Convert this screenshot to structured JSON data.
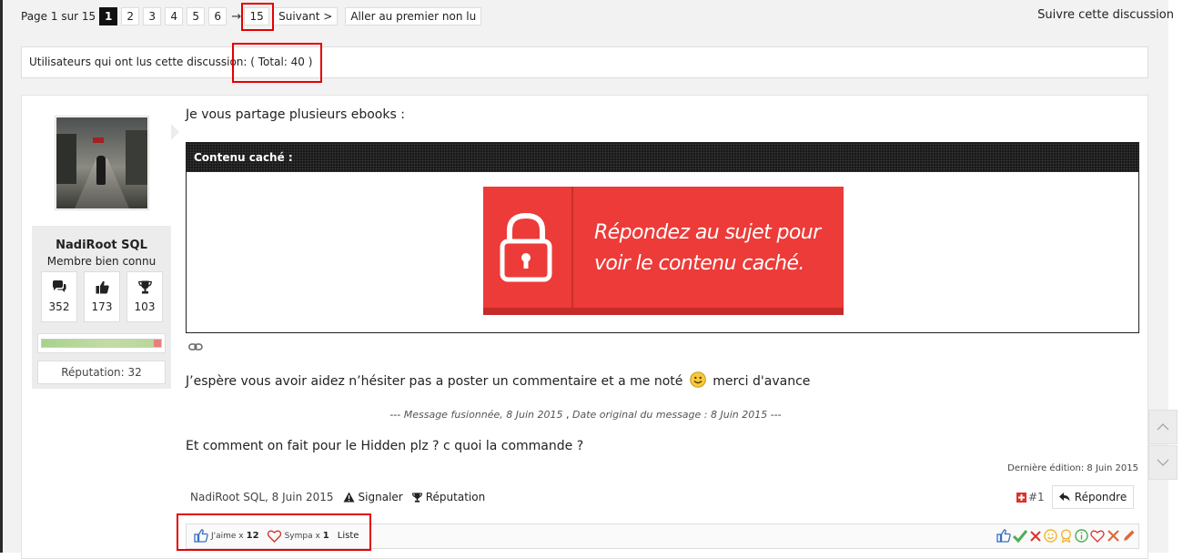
{
  "pagination": {
    "prefix": "Page 1 sur 15",
    "pages": [
      "1",
      "2",
      "3",
      "4",
      "5",
      "6"
    ],
    "arrow": "→",
    "last": "15",
    "next": "Suivant >",
    "first_unread": "Aller au premier non lu"
  },
  "follow": "Suivre cette discussion",
  "viewers": "Utilisateurs qui ont lus cette discussion: ( Total: 40 )",
  "user": {
    "name": "NadiRoot SQL",
    "title": "Membre bien connu",
    "stats": [
      {
        "icon": "comments-icon",
        "value": "352"
      },
      {
        "icon": "thumbs-up-icon",
        "value": "173"
      },
      {
        "icon": "trophy-icon",
        "value": "103"
      }
    ],
    "reputation_fill": 0.94,
    "reputation": "Réputation: 32"
  },
  "post": {
    "intro": "Je vous partage plusieurs ebooks :",
    "hidden_title": "Contenu caché :",
    "hidden_line1": "Répondez au sujet pour",
    "hidden_line2": "voir le contenu caché.",
    "message": "J’espère vous avoir aidez n’hésiter pas a poster un commentaire et a me noté",
    "message_end": "merci d'avance",
    "merged_a": "--- ",
    "merged_b": "Message fusionnée,",
    "merged_c": " 8 Juin 2015",
    "merged_d": " , ",
    "merged_e": "Date original du message :",
    "merged_f": " 8 Juin 2015",
    "merged_g": " ---",
    "question": "Et comment on fait pour le Hidden plz ? c quoi la commande ?",
    "last_edit": "Dernière édition: 8 Juin 2015",
    "author_date": "NadiRoot SQL, 8 Juin 2015",
    "report": "Signaler",
    "reputation": "Réputation",
    "number": "#1",
    "reply": "Répondre"
  },
  "likes": {
    "jaime_label": "J'aime x",
    "jaime_count": "12",
    "sympa_label": "Sympa x",
    "sympa_count": "1",
    "list": "Liste"
  },
  "colors": {
    "accent_red": "#ec3b38",
    "highlight_box": "#e40000"
  }
}
